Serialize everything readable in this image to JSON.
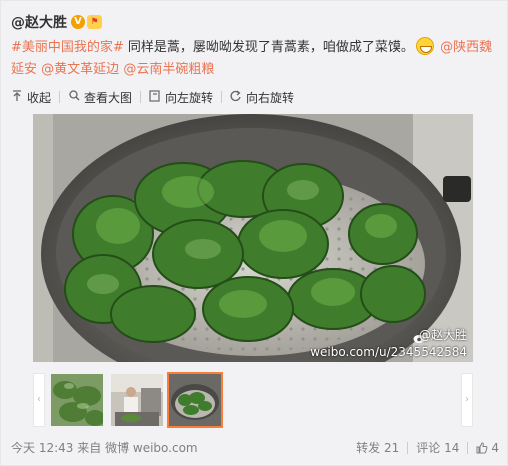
{
  "post": {
    "author": "@赵大胜",
    "badge_v": "V",
    "badge_level": "vip",
    "text_parts": {
      "topic": "#美丽中国我的家#",
      "body": " 同样是蒿，屡呦呦发现了青蒿素，咱做成了菜馍。",
      "mention1": "@陕西魏延安",
      "mention2": "@黄文革延边",
      "mention3": "@云南半碗粗粮"
    },
    "emoji": "laugh-emoji"
  },
  "toolbar": {
    "collapse": "收起",
    "view_large": "查看大图",
    "rotate_left": "向左旋转",
    "rotate_right": "向右旋转",
    "icons": [
      "collapse-up-icon",
      "magnifier-icon",
      "rotate-left-icon",
      "rotate-right-icon"
    ]
  },
  "photo": {
    "watermark_name": "@赵大胜",
    "watermark_url": "weibo.com/u/2345542584"
  },
  "thumbnails": {
    "count": 3,
    "selected_index": 2
  },
  "footer": {
    "time": "今天 12:43",
    "from_label": "来自",
    "source": "微博 weibo.com",
    "repost_label": "转发",
    "repost_count": "21",
    "comment_label": "评论",
    "comment_count": "14",
    "like_count": "4"
  },
  "colors": {
    "accent_link": "#eb7350",
    "selected_thumb_border": "#fa7d3c",
    "background": "#f2f2f5"
  }
}
